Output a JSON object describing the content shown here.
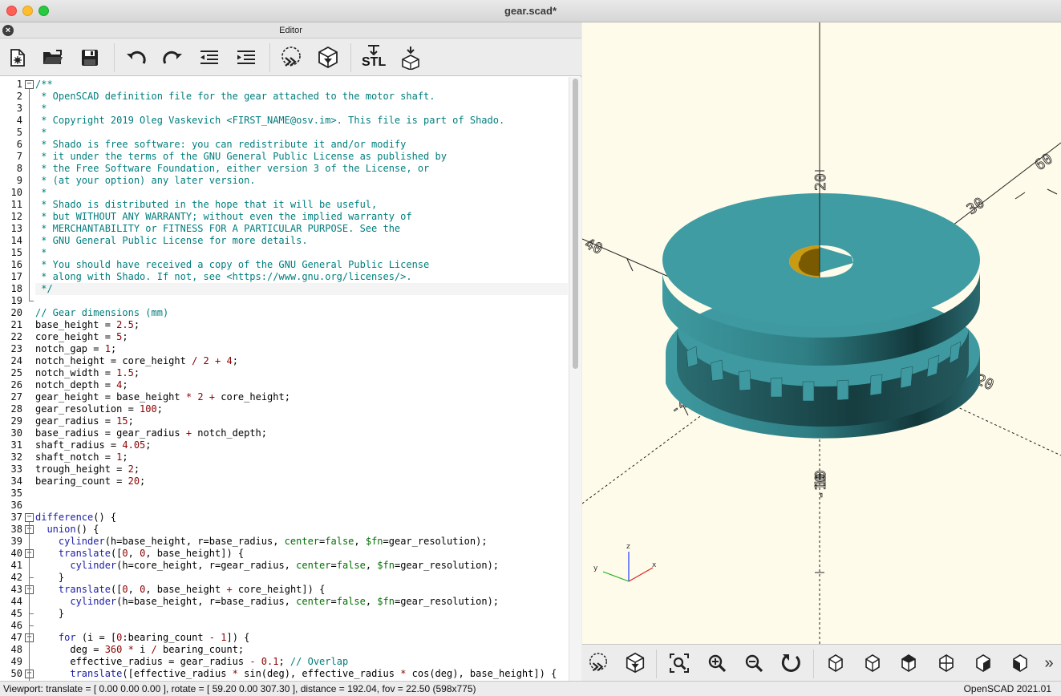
{
  "window": {
    "title": "gear.scad*"
  },
  "editor": {
    "title": "Editor",
    "toolbar": [
      "new-file",
      "open-file",
      "save",
      "undo",
      "redo",
      "unindent",
      "indent",
      "preview",
      "render",
      "export-stl",
      "send-to-3d-print"
    ],
    "toolbar_stl_label": "STL",
    "lines": [
      {
        "n": "1",
        "t": "/**"
      },
      {
        "n": "2",
        "t": " * OpenSCAD definition file for the gear attached to the motor shaft."
      },
      {
        "n": "3",
        "t": " *"
      },
      {
        "n": "4",
        "t": " * Copyright 2019 Oleg Vaskevich <FIRST_NAME@osv.im>. This file is part of Shado."
      },
      {
        "n": "5",
        "t": " *"
      },
      {
        "n": "6",
        "t": " * Shado is free software: you can redistribute it and/or modify"
      },
      {
        "n": "7",
        "t": " * it under the terms of the GNU General Public License as published by"
      },
      {
        "n": "8",
        "t": " * the Free Software Foundation, either version 3 of the License, or"
      },
      {
        "n": "9",
        "t": " * (at your option) any later version."
      },
      {
        "n": "10",
        "t": " *"
      },
      {
        "n": "11",
        "t": " * Shado is distributed in the hope that it will be useful,"
      },
      {
        "n": "12",
        "t": " * but WITHOUT ANY WARRANTY; without even the implied warranty of"
      },
      {
        "n": "13",
        "t": " * MERCHANTABILITY or FITNESS FOR A PARTICULAR PURPOSE. See the"
      },
      {
        "n": "14",
        "t": " * GNU General Public License for more details."
      },
      {
        "n": "15",
        "t": " *"
      },
      {
        "n": "16",
        "t": " * You should have received a copy of the GNU General Public License"
      },
      {
        "n": "17",
        "t": " * along with Shado. If not, see <https://www.gnu.org/licenses/>."
      },
      {
        "n": "18",
        "t": " */"
      },
      {
        "n": "19",
        "t": ""
      },
      {
        "n": "20",
        "t": "// Gear dimensions (mm)"
      },
      {
        "n": "21",
        "t": "base_height = 2.5;"
      },
      {
        "n": "22",
        "t": "core_height = 5;"
      },
      {
        "n": "23",
        "t": "notch_gap = 1;"
      },
      {
        "n": "24",
        "t": "notch_height = core_height / 2 + 4;"
      },
      {
        "n": "25",
        "t": "notch_width = 1.5;"
      },
      {
        "n": "26",
        "t": "notch_depth = 4;"
      },
      {
        "n": "27",
        "t": "gear_height = base_height * 2 + core_height;"
      },
      {
        "n": "28",
        "t": "gear_resolution = 100;"
      },
      {
        "n": "29",
        "t": "gear_radius = 15;"
      },
      {
        "n": "30",
        "t": "base_radius = gear_radius + notch_depth;"
      },
      {
        "n": "31",
        "t": "shaft_radius = 4.05;"
      },
      {
        "n": "32",
        "t": "shaft_notch = 1;"
      },
      {
        "n": "33",
        "t": "trough_height = 2;"
      },
      {
        "n": "34",
        "t": "bearing_count = 20;"
      },
      {
        "n": "35",
        "t": ""
      },
      {
        "n": "36",
        "t": ""
      },
      {
        "n": "37",
        "t": "difference() {"
      },
      {
        "n": "38",
        "t": "  union() {"
      },
      {
        "n": "39",
        "t": "    cylinder(h=base_height, r=base_radius, center=false, $fn=gear_resolution);"
      },
      {
        "n": "40",
        "t": "    translate([0, 0, base_height]) {"
      },
      {
        "n": "41",
        "t": "      cylinder(h=core_height, r=gear_radius, center=false, $fn=gear_resolution);"
      },
      {
        "n": "42",
        "t": "    }"
      },
      {
        "n": "43",
        "t": "    translate([0, 0, base_height + core_height]) {"
      },
      {
        "n": "44",
        "t": "      cylinder(h=base_height, r=base_radius, center=false, $fn=gear_resolution);"
      },
      {
        "n": "45",
        "t": "    }"
      },
      {
        "n": "46",
        "t": ""
      },
      {
        "n": "47",
        "t": "    for (i = [0:bearing_count - 1]) {"
      },
      {
        "n": "48",
        "t": "      deg = 360 * i / bearing_count;"
      },
      {
        "n": "49",
        "t": "      effective_radius = gear_radius - 0.1; // Overlap"
      },
      {
        "n": "50",
        "t": "      translate([effective_radius * sin(deg), effective_radius * cos(deg), base_height]) {"
      }
    ]
  },
  "viewport": {
    "axis_labels": {
      "x": "x",
      "y": "y",
      "z": "z"
    },
    "tick_labels": [
      "20",
      "40",
      "60",
      "-20",
      "-40",
      "10",
      "-10",
      "-20",
      "20",
      "30"
    ],
    "model_color": "#3e9aa0",
    "background": "#fffbea"
  },
  "view_toolbar": [
    "preview",
    "render",
    "view-all",
    "zoom-in",
    "zoom-out",
    "reset-view",
    "view-right",
    "view-top",
    "view-bottom",
    "view-left",
    "view-front",
    "view-back",
    "more"
  ],
  "view_toolbar_more": "»",
  "status": {
    "left": "Viewport: translate = [ 0.00 0.00 0.00 ], rotate = [ 59.20 0.00 307.30 ], distance = 192.04, fov = 22.50 (598x775)",
    "right": "OpenSCAD 2021.01"
  }
}
